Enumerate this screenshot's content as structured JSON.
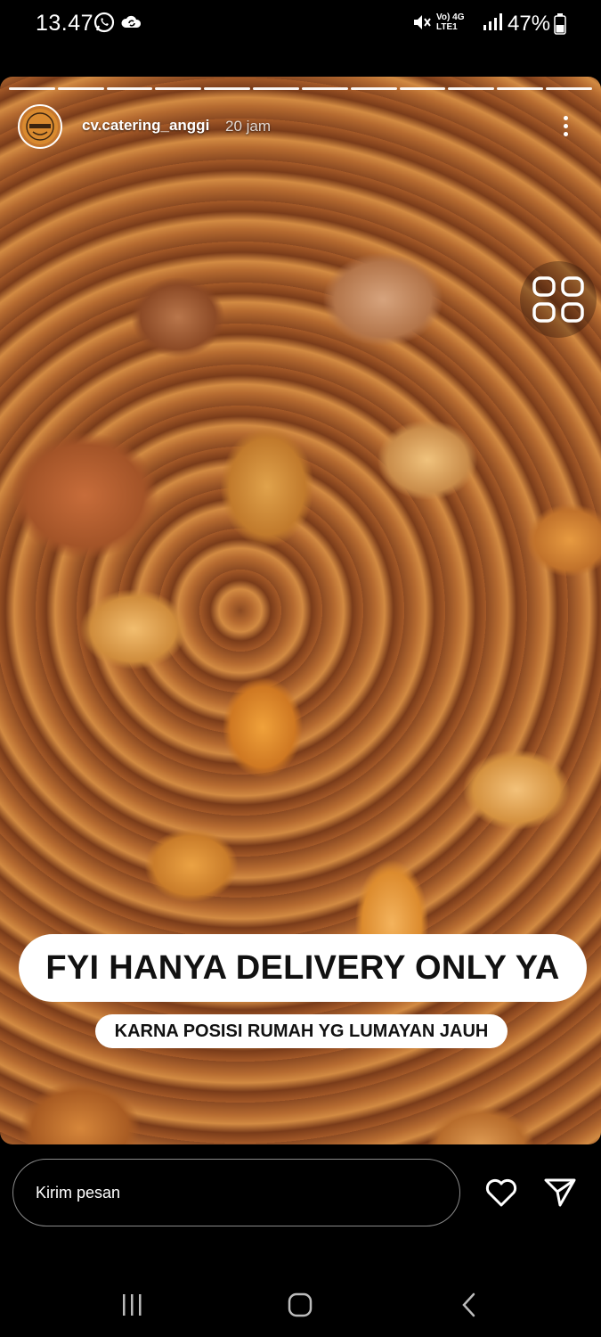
{
  "status_bar": {
    "time": "13.47",
    "battery": "47%",
    "network_label": "Vo) 4G LTE1"
  },
  "story": {
    "username": "cv.catering_anggi",
    "time_ago": "20 jam",
    "segments": 12,
    "caption_main": "FYI HANYA DELIVERY ONLY YA",
    "caption_sub": "KARNA POSISI RUMAH YG LUMAYAN JAUH",
    "image_subject": "spicy fried cassava chips"
  },
  "reply_bar": {
    "message_placeholder": "Kirim pesan"
  },
  "icons": {
    "whatsapp": "whatsapp-icon",
    "cloud": "cloud-sync-icon",
    "mute": "mute-icon",
    "signal": "signal-icon",
    "battery": "battery-icon",
    "more": "more-options-icon",
    "heart": "heart-icon",
    "send": "send-icon",
    "floating": "floating-shortcut-icon"
  }
}
